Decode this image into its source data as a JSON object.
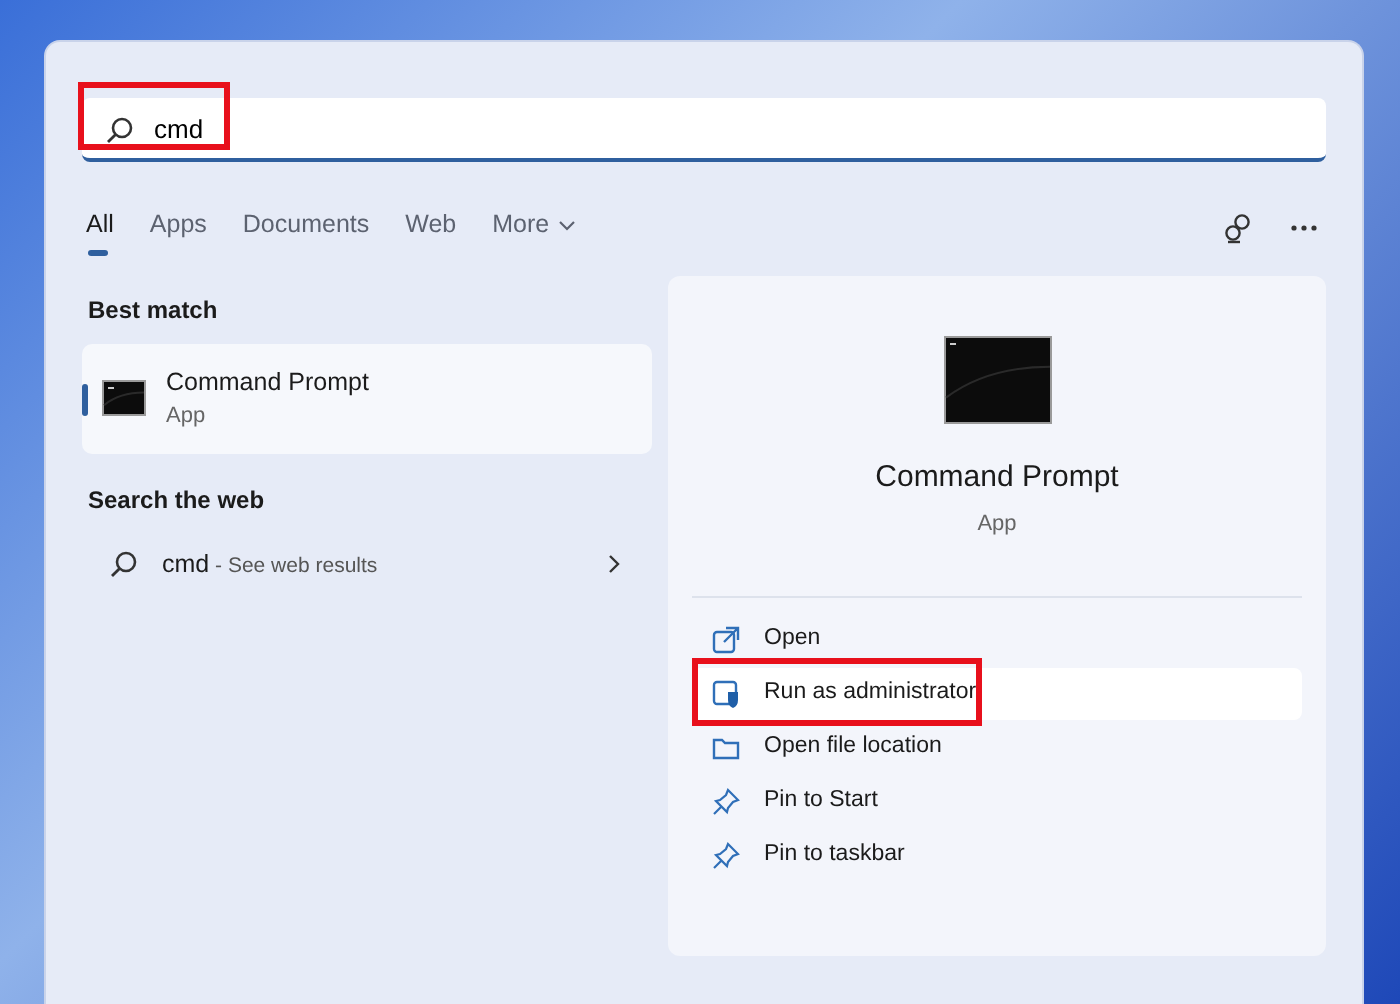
{
  "search": {
    "value": "cmd",
    "annotated": true
  },
  "tabs": [
    {
      "label": "All",
      "selected": true
    },
    {
      "label": "Apps",
      "selected": false
    },
    {
      "label": "Documents",
      "selected": false
    },
    {
      "label": "Web",
      "selected": false
    },
    {
      "label": "More",
      "selected": false,
      "dropdown": true
    }
  ],
  "best_match": {
    "heading": "Best match",
    "title": "Command Prompt",
    "subtitle": "App",
    "selected": true
  },
  "web": {
    "heading": "Search the web",
    "query": "cmd",
    "hint": "- See web results"
  },
  "details": {
    "title": "Command Prompt",
    "subtitle": "App",
    "actions": [
      {
        "kind": "open",
        "label": "Open",
        "hovered": false,
        "annotated": false
      },
      {
        "kind": "admin",
        "label": "Run as administrator",
        "hovered": true,
        "annotated": true
      },
      {
        "kind": "folder",
        "label": "Open file location",
        "hovered": false,
        "annotated": false
      },
      {
        "kind": "pin",
        "label": "Pin to Start",
        "hovered": false,
        "annotated": false
      },
      {
        "kind": "pin",
        "label": "Pin to taskbar",
        "hovered": false,
        "annotated": false
      }
    ]
  }
}
